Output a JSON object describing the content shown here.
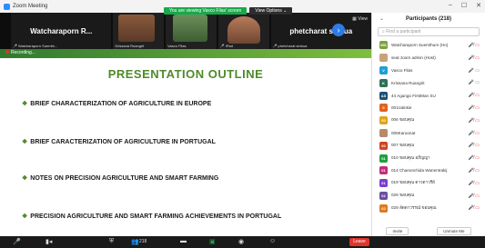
{
  "window": {
    "title": "Zoom Meeting",
    "controls": [
      "–",
      "☐",
      "✕"
    ]
  },
  "viewbar": {
    "viewing": "You are viewing Vasco Filas' screen",
    "options": "View Options ⌄"
  },
  "video_strip": {
    "tiles": [
      {
        "big_name": "Watcharaporn  R...",
        "caption": "Watcharaporn Suemth..."
      },
      {
        "caption": "Krissana Ruangrit"
      },
      {
        "caption": "Vasco Filas"
      },
      {
        "caption": "iPad"
      },
      {
        "big_name": "phetcharat sinbua",
        "caption": "phetcharat sinbua"
      }
    ],
    "view_label": "▦ View",
    "next_icon": "›"
  },
  "slide": {
    "recording": "Recording...",
    "title": "PRESENTATION OUTLINE",
    "bullets": [
      "BRIEF CHARACTERIZATION OF AGRICULTURE IN EUROPE",
      "BRIEF CARACTERIZATION OF AGRICULTURE IN PORTUGAL",
      "NOTES ON PRECISION AGRICULTURE AND SMART FARMING",
      "PRECISION AGRICULTURE AND SMART FARMING ACHIEVEMENTS IN PORTUGAL"
    ]
  },
  "toolbar": {
    "participants_count": "218",
    "leave": "Leave"
  },
  "participants": {
    "title": "Participants (218)",
    "search_placeholder": "Find a participant",
    "list": [
      {
        "initials": "WS",
        "color": "#7aa23c",
        "name": "Watcharaporn Suemthum (Ho)",
        "muted": true
      },
      {
        "initials": "",
        "color": "#c9a27a",
        "name": "seat zoom admin (Host)",
        "muted": true
      },
      {
        "initials": "V",
        "color": "#1f9fd6",
        "name": "Vasco Filas",
        "muted": false
      },
      {
        "initials": "K",
        "color": "#2f6f5a",
        "name": "Krissana Ruangrit",
        "muted": false
      },
      {
        "initials": "AS",
        "color": "#1f4f7a",
        "name": "44 Agungo FirstMan SU",
        "muted": true
      },
      {
        "initials": "0",
        "color": "#e0631f",
        "name": "001ratinkie",
        "muted": true
      },
      {
        "initials": "00",
        "color": "#e0a31f",
        "name": "006 ขอบคุณ",
        "muted": true
      },
      {
        "initials": "",
        "color": "#b58a6a",
        "name": "006Karuonat",
        "muted": true
      },
      {
        "initials": "00",
        "color": "#d0451f",
        "name": "007 ขอบคุณ",
        "muted": true
      },
      {
        "initials": "01",
        "color": "#1f9f3f",
        "name": "010 ขอบคุณ อภิญญา",
        "muted": true
      },
      {
        "initials": "01",
        "color": "#c02f7a",
        "name": "014 Chanonchida Wanentrakij",
        "muted": true
      },
      {
        "initials": "01",
        "color": "#7a3fd0",
        "name": "019 ขอบคุณ ดาวดาวรีย์",
        "muted": true
      },
      {
        "initials": "02",
        "color": "#6a4f9f",
        "name": "026 ขอบคุณ",
        "muted": true
      },
      {
        "initials": "02",
        "color": "#e07a1f",
        "name": "029 ลัดดาวรรณ์ ขอบคุณ",
        "muted": true
      }
    ],
    "invite": "Invite",
    "unmute": "Unmute Me"
  }
}
